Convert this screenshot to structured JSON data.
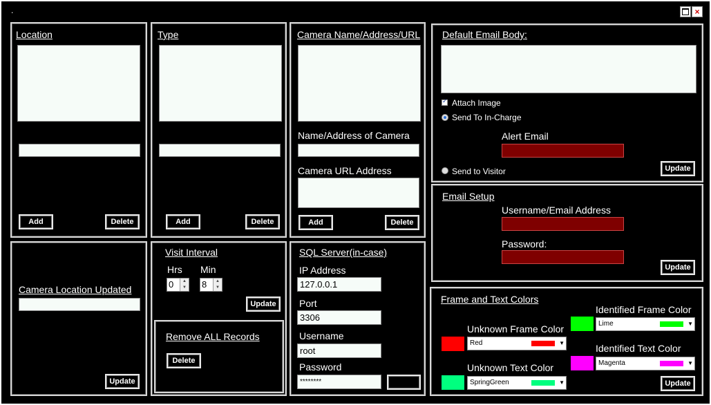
{
  "window": {
    "title": "."
  },
  "location": {
    "title": "Location",
    "add": "Add",
    "delete": "Delete"
  },
  "type": {
    "title": "Type",
    "add": "Add",
    "delete": "Delete"
  },
  "camera": {
    "title": "Camera Name/Address/URL",
    "name_label": "Name/Address of Camera",
    "url_label": "Camera URL Address",
    "add": "Add",
    "delete": "Delete"
  },
  "camera_location": {
    "label": "Camera Location Updated",
    "update": "Update"
  },
  "visit_interval": {
    "title": "Visit Interval",
    "hrs_label": "Hrs",
    "min_label": "Min",
    "hrs_value": "0",
    "min_value": "8",
    "update": "Update"
  },
  "remove_records": {
    "title": "Remove ALL Records",
    "delete": "Delete"
  },
  "sql": {
    "title": "SQL Server(in-case)",
    "ip_label": "IP Address",
    "ip_value": "127.0.0.1",
    "port_label": "Port",
    "port_value": "3306",
    "username_label": "Username",
    "username_value": "root",
    "password_label": "Password",
    "password_value": "********"
  },
  "email_body": {
    "title": "Default Email Body:",
    "attach_image": "Attach Image",
    "send_incharge": "Send To In-Charge",
    "alert_email": "Alert Email",
    "send_visitor": "Send to Visitor",
    "update": "Update"
  },
  "email_setup": {
    "title": "Email Setup",
    "username_label": "Username/Email Address",
    "password_label": "Password:",
    "update": "Update"
  },
  "colors": {
    "title": "Frame and Text Colors",
    "unknown_frame_label": "Unknown Frame Color",
    "unknown_frame_value": "Red",
    "unknown_frame_hex": "#ff0000",
    "unknown_text_label": "Unknown Text Color",
    "unknown_text_value": "SpringGreen",
    "unknown_text_hex": "#00ff7f",
    "identified_frame_label": "Identified Frame Color",
    "identified_frame_value": "Lime",
    "identified_frame_hex": "#00ff00",
    "identified_text_label": "Identified Text Color",
    "identified_text_value": "Magenta",
    "identified_text_hex": "#ff00ff",
    "update": "Update"
  }
}
